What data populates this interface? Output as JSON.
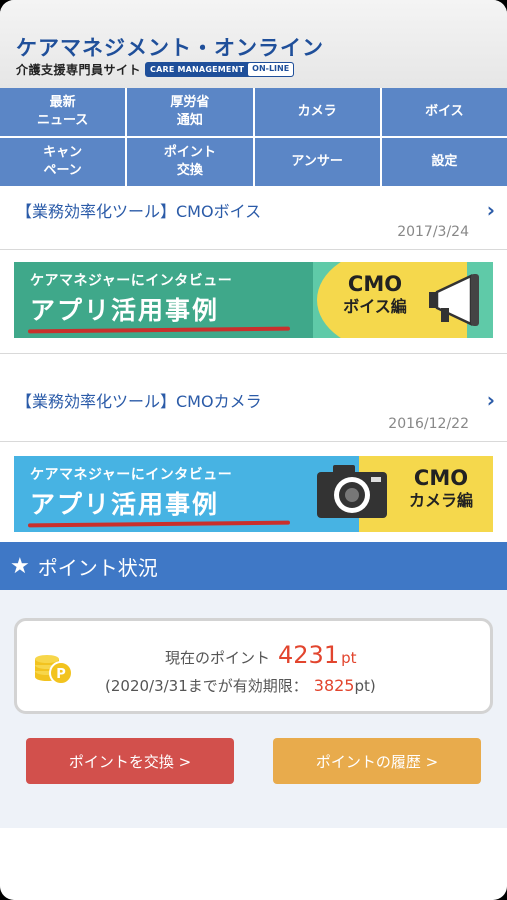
{
  "header": {
    "title": "ケアマネジメント・オンライン",
    "subtitle": "介護支援専門員サイト",
    "badge_left": "CARE MANAGEMENT",
    "badge_right": "ON-LINE"
  },
  "menu": [
    {
      "label": "最新\nニュース"
    },
    {
      "label": "厚労省\n通知"
    },
    {
      "label": "カメラ"
    },
    {
      "label": "ボイス"
    },
    {
      "label": "キャン\nペーン"
    },
    {
      "label": "ポイント\n交換"
    },
    {
      "label": "アンサー"
    },
    {
      "label": "設定"
    }
  ],
  "news": [
    {
      "title": "【業務効率化ツール】CMOボイス",
      "date": "2017/3/24",
      "chevron": "chevron-right-icon"
    },
    {
      "title": "【業務効率化ツール】CMOカメラ",
      "date": "2016/12/22",
      "chevron": "chevron-right-icon"
    }
  ],
  "banners": [
    {
      "lead": "ケアマネジャーにインタビュー",
      "big": "アプリ活用事例",
      "right_line1": "CMO",
      "right_line2": "ボイス編",
      "icon": "megaphone-icon"
    },
    {
      "lead": "ケアマネジャーにインタビュー",
      "big": "アプリ活用事例",
      "right_line1": "CMO",
      "right_line2": "カメラ編",
      "icon": "camera-icon"
    }
  ],
  "points": {
    "header": "ポイント状況",
    "star_icon": "star-icon",
    "current_label": "現在のポイント",
    "current_value": "4231",
    "unit": "pt",
    "expiry_label": "(2020/3/31までが有効期限：",
    "expiry_value": "3825",
    "expiry_unit": "pt)",
    "exchange_button": "ポイントを交換 >",
    "history_button": "ポイントの履歴 >"
  },
  "colors": {
    "brand_blue": "#1f4f9a",
    "menu_blue": "#5b86c6",
    "points_header": "#3f78c6",
    "accent_red": "#e2452e",
    "exchange_btn": "#d2504c",
    "history_btn": "#e8ab4c"
  }
}
